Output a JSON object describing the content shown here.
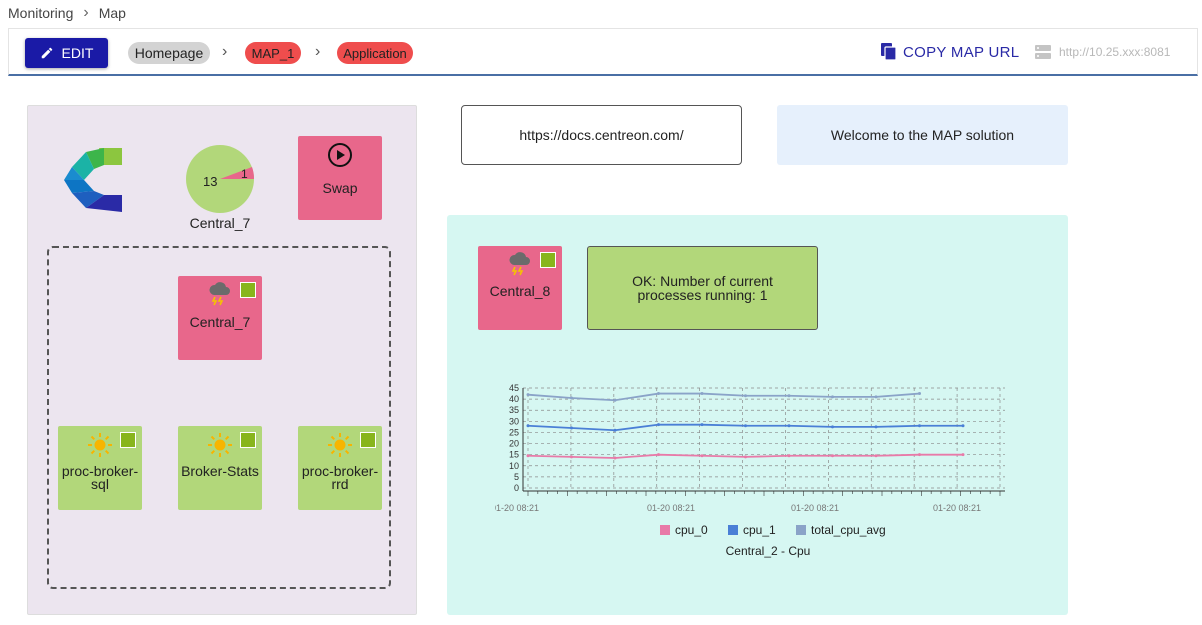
{
  "breadcrumb": {
    "items": [
      "Monitoring",
      "Map"
    ]
  },
  "toolbar": {
    "edit_label": "EDIT",
    "path": [
      "Homepage",
      "MAP_1",
      "Application"
    ],
    "copy_label": "COPY MAP URL",
    "server": "http://10.25.xxx:8081",
    "accent": "#1a1aa6"
  },
  "left": {
    "pie": {
      "label": "Central_7",
      "ok": 13,
      "crit": 1
    },
    "swap_label": "Swap",
    "group": {
      "host": {
        "label": "Central_7",
        "state": "critical"
      },
      "services": [
        {
          "label": "proc-broker-sql"
        },
        {
          "label": "Broker-Stats"
        },
        {
          "label": "proc-broker-rrd"
        }
      ]
    }
  },
  "url_text": "https://docs.centreon.com/",
  "welcome_text": "Welcome to the MAP solution",
  "right": {
    "host": {
      "label": "Central_8"
    },
    "status_text": "OK: Number of current processes running: 1"
  },
  "chart_data": {
    "type": "line",
    "title": "Central_2 - Cpu",
    "ylim": [
      0,
      45
    ],
    "yticks": [
      0,
      5,
      10,
      15,
      20,
      25,
      30,
      35,
      40,
      45
    ],
    "xtick_labels": [
      "01-20 08:21",
      "01-20 08:21",
      "01-20 08:21",
      "01-20 08:21"
    ],
    "grid": true,
    "legend_placement": "bottom",
    "series": [
      {
        "name": "cpu_0",
        "color": "#e87aa8",
        "values": [
          14.5,
          14,
          13.5,
          15,
          14.5,
          14,
          14.5,
          14.5,
          14.5,
          15,
          15
        ]
      },
      {
        "name": "cpu_1",
        "color": "#4a7fd6",
        "values": [
          28,
          27,
          26,
          28.5,
          28.5,
          28,
          28,
          27.5,
          27.5,
          28,
          28
        ]
      },
      {
        "name": "total_cpu_avg",
        "color": "#8aa3c8",
        "values": [
          42,
          40.5,
          39.5,
          42.5,
          42.5,
          41.5,
          41.5,
          41,
          41,
          42.5
        ]
      }
    ]
  },
  "colors": {
    "critical": "#e8678b",
    "ok": "#b2d77a",
    "ok_square": "#88b51c"
  },
  "icons": {
    "edit": "pencil-icon",
    "copy": "copy-icon",
    "server": "server-icon",
    "play": "play-circle-icon",
    "storm": "storm-cloud-icon",
    "sun": "sun-icon",
    "logo": "centreon-logo"
  }
}
